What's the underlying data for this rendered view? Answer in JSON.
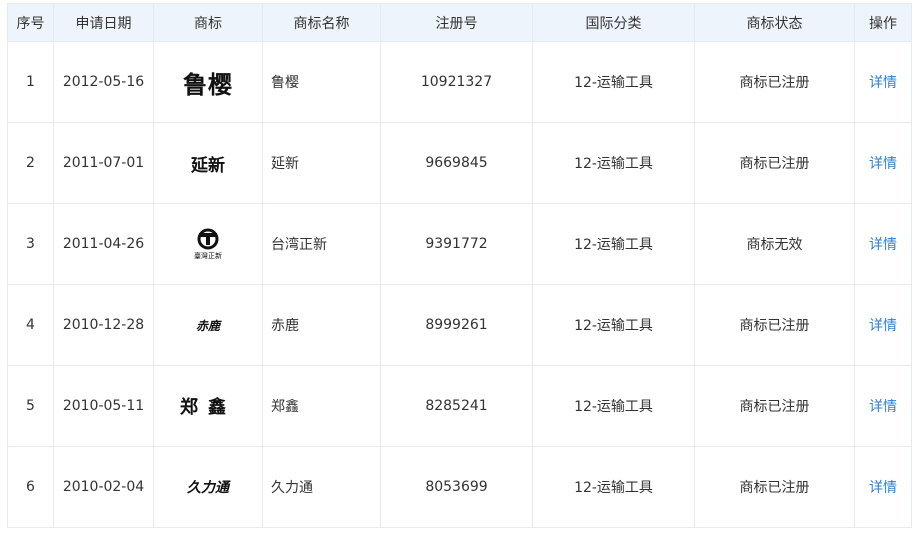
{
  "table": {
    "headers": [
      "序号",
      "申请日期",
      "商标",
      "商标名称",
      "注册号",
      "国际分类",
      "商标状态",
      "操作"
    ],
    "rows": [
      {
        "index": "1",
        "date": "2012-05-16",
        "logo_text": "鲁樱",
        "name": "鲁樱",
        "reg_no": "10921327",
        "class": "12-运输工具",
        "status": "商标已注册",
        "action": "详情"
      },
      {
        "index": "2",
        "date": "2011-07-01",
        "logo_text": "延新",
        "name": "延新",
        "reg_no": "9669845",
        "class": "12-运输工具",
        "status": "商标已注册",
        "action": "详情"
      },
      {
        "index": "3",
        "date": "2011-04-26",
        "logo_text": "臺灣正新",
        "name": "台湾正新",
        "reg_no": "9391772",
        "class": "12-运输工具",
        "status": "商标无效",
        "action": "详情"
      },
      {
        "index": "4",
        "date": "2010-12-28",
        "logo_text": "赤鹿",
        "name": "赤鹿",
        "reg_no": "8999261",
        "class": "12-运输工具",
        "status": "商标已注册",
        "action": "详情"
      },
      {
        "index": "5",
        "date": "2010-05-11",
        "logo_text": "郑鑫",
        "name": "郑鑫",
        "reg_no": "8285241",
        "class": "12-运输工具",
        "status": "商标已注册",
        "action": "详情"
      },
      {
        "index": "6",
        "date": "2010-02-04",
        "logo_text": "久力通",
        "name": "久力通",
        "reg_no": "8053699",
        "class": "12-运输工具",
        "status": "商标已注册",
        "action": "详情"
      }
    ]
  },
  "colors": {
    "header_bg": "#eef4fb",
    "border": "#e4ebf3",
    "link": "#2f7fd1"
  }
}
